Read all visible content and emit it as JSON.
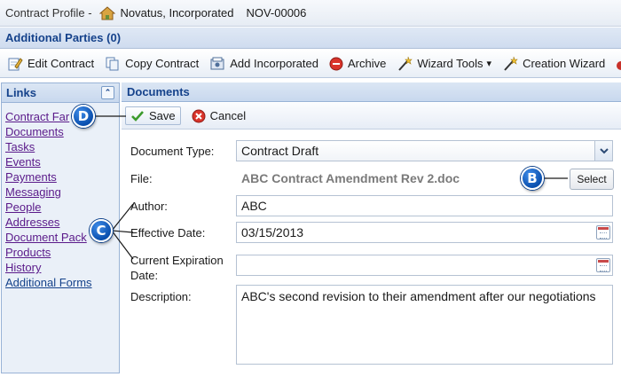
{
  "title_bar": {
    "label": "Contract Profile -",
    "company": "Novatus, Incorporated",
    "contract_id": "NOV-00006",
    "icon": "house-icon"
  },
  "parties_bar": {
    "label": "Additional Parties (0)"
  },
  "toolbar": {
    "items": [
      {
        "label": "Edit Contract",
        "icon": "edit-icon"
      },
      {
        "label": "Copy Contract",
        "icon": "copy-icon"
      },
      {
        "label": "Add Incorporated",
        "icon": "add-document-icon"
      },
      {
        "label": "Archive",
        "icon": "archive-icon"
      },
      {
        "label": "Wizard Tools",
        "icon": "wand-icon"
      },
      {
        "label": "Creation Wizard",
        "icon": "wand-icon"
      }
    ],
    "dropdown_arrow": "▾"
  },
  "links_panel": {
    "title": "Links",
    "collapse_glyph": "⌃",
    "items": [
      "Contract Far",
      "Documents",
      "Tasks",
      "Events",
      "Payments",
      "Messaging",
      "People",
      "Addresses",
      "Document Pack",
      "Products",
      "History",
      "Additional Forms"
    ]
  },
  "documents": {
    "title": "Documents",
    "save_label": "Save",
    "cancel_label": "Cancel",
    "form": {
      "document_type_label": "Document Type:",
      "document_type_value": "Contract Draft",
      "file_label": "File:",
      "file_value": "ABC Contract Amendment Rev 2.doc",
      "select_label": "Select",
      "author_label": "Author:",
      "author_value": "ABC",
      "effective_date_label": "Effective Date:",
      "effective_date_value": "03/15/2013",
      "expiration_label_line1": "Current Expiration",
      "expiration_label_line2": "Date:",
      "expiration_value": "",
      "description_label": "Description:",
      "description_value": "ABC's second revision to their amendment after our negotiations"
    }
  },
  "callouts": {
    "b": "B",
    "c": "C",
    "d": "D"
  },
  "colors": {
    "header_text": "#15428b",
    "link": "#5a1a8a",
    "callout": "#0a4fae"
  }
}
